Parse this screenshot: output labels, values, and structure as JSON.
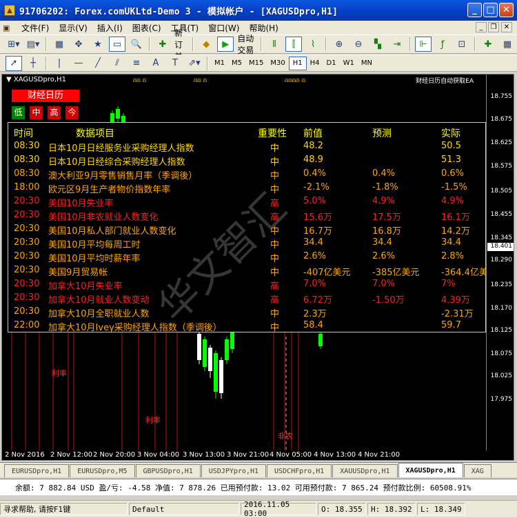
{
  "window": {
    "title": "91706202: Forex.comUKLtd-Demo 3 - 模拟帐户 - [XAGUSDpro,H1]"
  },
  "menu": [
    "文件(F)",
    "显示(V)",
    "插入(I)",
    "图表(C)",
    "工具(T)",
    "窗口(W)",
    "帮助(H)"
  ],
  "toolbar": {
    "new_order": "新订单",
    "auto_trade": "自动交易"
  },
  "timeframes": [
    "M1",
    "M5",
    "M15",
    "M30",
    "H1",
    "H4",
    "D1",
    "W1",
    "MN"
  ],
  "active_timeframe": "H1",
  "chart": {
    "symbol": "XAGUSDpro,H1",
    "ea_label": "财经日历自动获取EA",
    "calendar_button": "财经日历",
    "filters": [
      "低",
      "中",
      "高",
      "今"
    ],
    "current_price": "18.401",
    "y_ticks": [
      "18.755",
      "18.675",
      "18.625",
      "18.575",
      "18.505",
      "18.455",
      "18.345",
      "18.290",
      "18.235",
      "18.170",
      "18.125",
      "18.075",
      "18.025",
      "17.975"
    ],
    "x_ticks": [
      "2 Nov 2016",
      "2 Nov 12:00",
      "2 Nov 20:00",
      "3 Nov 04:00",
      "3 Nov 13:00",
      "3 Nov 21:00",
      "4 Nov 05:00",
      "4 Nov 13:00",
      "4 Nov 21:00"
    ],
    "annotations": [
      "利率",
      "利率",
      "非农"
    ],
    "watermark": "华文智汇"
  },
  "calendar": {
    "headers": [
      "时间",
      "数据项目",
      "重要性",
      "前值",
      "预测",
      "实际"
    ],
    "rows": [
      {
        "time": "08:30",
        "item": "日本10月日经服务业采购经理人指数",
        "importance": "中",
        "previous": "48.2",
        "forecast": "",
        "actual": "50.5",
        "color": "#ffd700"
      },
      {
        "time": "08:30",
        "item": "日本10月日经综合采购经理人指数",
        "importance": "中",
        "previous": "48.9",
        "forecast": "",
        "actual": "51.3",
        "color": "#ffd700"
      },
      {
        "time": "08:30",
        "item": "澳大利亚9月零售销售月率（季调後）",
        "importance": "中",
        "previous": "0.4%",
        "forecast": "0.4%",
        "actual": "0.6%",
        "color": "#ffa500"
      },
      {
        "time": "18:00",
        "item": "欧元区9月生产者物价指数年率",
        "importance": "中",
        "previous": "-2.1%",
        "forecast": "-1.8%",
        "actual": "-1.5%",
        "color": "#ffa500"
      },
      {
        "time": "20:30",
        "item": "美国10月失业率",
        "importance": "高",
        "previous": "5.0%",
        "forecast": "4.9%",
        "actual": "4.9%",
        "color": "#ff2020"
      },
      {
        "time": "20:30",
        "item": "美国10月非农就业人数变化",
        "importance": "高",
        "previous": "15.6万",
        "forecast": "17.5万",
        "actual": "16.1万",
        "color": "#ff2020"
      },
      {
        "time": "20:30",
        "item": "美国10月私人部门就业人数变化",
        "importance": "中",
        "previous": "16.7万",
        "forecast": "16.8万",
        "actual": "14.2万",
        "color": "#ffa500"
      },
      {
        "time": "20:30",
        "item": "美国10月平均每周工时",
        "importance": "中",
        "previous": "34.4",
        "forecast": "34.4",
        "actual": "34.4",
        "color": "#ffa500"
      },
      {
        "time": "20:30",
        "item": "美国10月平均时薪年率",
        "importance": "中",
        "previous": "2.6%",
        "forecast": "2.6%",
        "actual": "2.8%",
        "color": "#ffa500"
      },
      {
        "time": "20:30",
        "item": "美国9月贸易帐",
        "importance": "中",
        "previous": "-407亿美元",
        "forecast": "-385亿美元",
        "actual": "-364.4亿美",
        "color": "#ffa500"
      },
      {
        "time": "20:30",
        "item": "加拿大10月失业率",
        "importance": "高",
        "previous": "7.0%",
        "forecast": "7.0%",
        "actual": "7%",
        "color": "#ff2020"
      },
      {
        "time": "20:30",
        "item": "加拿大10月就业人数变动",
        "importance": "高",
        "previous": "6.72万",
        "forecast": "-1.50万",
        "actual": "4.39万",
        "color": "#ff2020"
      },
      {
        "time": "20:30",
        "item": "加拿大10月全职就业人数",
        "importance": "中",
        "previous": "2.3万",
        "forecast": "",
        "actual": "-2.31万",
        "color": "#ffa500"
      },
      {
        "time": "22:00",
        "item": "加拿大10月Ivey采购经理人指数（季调後）",
        "importance": "中",
        "previous": "58.4",
        "forecast": "",
        "actual": "59.7",
        "color": "#ffa500"
      }
    ]
  },
  "tabs": [
    "EURUSDpro,H1",
    "EURUSDpro,M5",
    "GBPUSDpro,H1",
    "USDJPYpro,H1",
    "USDCHFpro,H1",
    "XAUUSDpro,H1",
    "XAGUSDpro,H1",
    "XAG"
  ],
  "active_tab": "XAGUSDpro,H1",
  "account": {
    "text": "余额: 7 882.84 USD  盈/亏: -4.58  净值: 7 878.26  已用预付款: 13.02  可用预付款: 7 865.24  预付款比例: 60508.91%"
  },
  "status": {
    "help": "寻求帮助, 请按F1键",
    "profile": "Default",
    "datetime": "2016.11.05 03:00",
    "open": "O: 18.355",
    "high": "H: 18.392",
    "low": "L: 18.349"
  }
}
